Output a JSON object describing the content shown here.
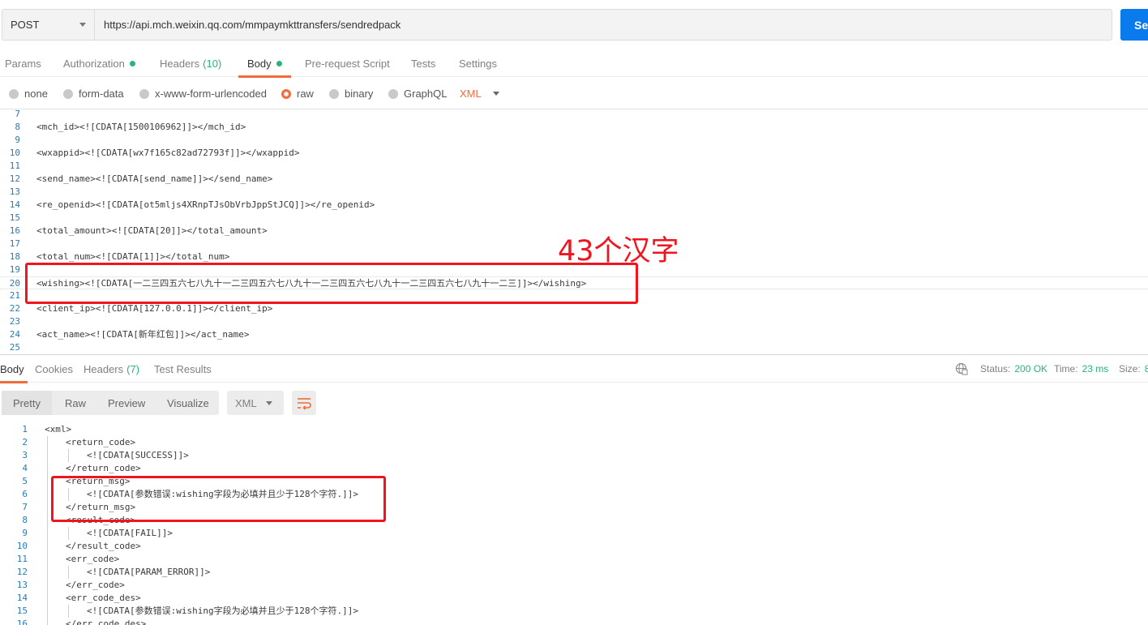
{
  "request": {
    "method": "POST",
    "url": "https://api.mch.weixin.qq.com/mmpaymkttransfers/sendredpack",
    "send_label": "Se"
  },
  "request_tabs": [
    {
      "label": "Params"
    },
    {
      "label": "Authorization"
    },
    {
      "label": "Headers",
      "count": "(10)"
    },
    {
      "label": "Body"
    },
    {
      "label": "Pre-request Script"
    },
    {
      "label": "Tests"
    },
    {
      "label": "Settings"
    }
  ],
  "body_types": [
    {
      "label": "none"
    },
    {
      "label": "form-data"
    },
    {
      "label": "x-www-form-urlencoded"
    },
    {
      "label": "raw"
    },
    {
      "label": "binary"
    },
    {
      "label": "GraphQL"
    }
  ],
  "body_format": "XML",
  "editor_lines": [
    {
      "num": "7",
      "code": ""
    },
    {
      "num": "8",
      "code": "<mch_id><![CDATA[1500106962]]></mch_id>"
    },
    {
      "num": "9",
      "code": ""
    },
    {
      "num": "10",
      "code": "<wxappid><![CDATA[wx7f165c82ad72793f]]></wxappid>"
    },
    {
      "num": "11",
      "code": ""
    },
    {
      "num": "12",
      "code": "<send_name><![CDATA[send_name]]></send_name>"
    },
    {
      "num": "13",
      "code": ""
    },
    {
      "num": "14",
      "code": "<re_openid><![CDATA[ot5mljs4XRnpTJsObVrbJppStJCQ]]></re_openid>"
    },
    {
      "num": "15",
      "code": ""
    },
    {
      "num": "16",
      "code": "<total_amount><![CDATA[20]]></total_amount>"
    },
    {
      "num": "17",
      "code": ""
    },
    {
      "num": "18",
      "code": "<total_num><![CDATA[1]]></total_num>"
    },
    {
      "num": "19",
      "code": ""
    },
    {
      "num": "20",
      "code": "<wishing><![CDATA[一二三四五六七八九十一二三四五六七八九十一二三四五六七八九十一二三四五六七八九十一二三]]></wishing>"
    },
    {
      "num": "21",
      "code": ""
    },
    {
      "num": "22",
      "code": "<client_ip><![CDATA[127.0.0.1]]></client_ip>"
    },
    {
      "num": "23",
      "code": ""
    },
    {
      "num": "24",
      "code": "<act_name><![CDATA[新年红包]]></act_name>"
    },
    {
      "num": "25",
      "code": ""
    }
  ],
  "annotation": "43个汉字",
  "response_tabs": [
    {
      "label": "Body"
    },
    {
      "label": "Cookies"
    },
    {
      "label": "Headers",
      "count": "(7)"
    },
    {
      "label": "Test Results"
    }
  ],
  "response_status": {
    "status_label": "Status:",
    "status_value": "200 OK",
    "time_label": "Time:",
    "time_value": "23 ms",
    "size_label": "Size:",
    "size_value": "8"
  },
  "view_tabs": [
    "Pretty",
    "Raw",
    "Preview",
    "Visualize"
  ],
  "response_format": "XML",
  "response_lines": [
    {
      "num": "1",
      "indent": 0,
      "code": "<xml>"
    },
    {
      "num": "2",
      "indent": 1,
      "code": "<return_code>"
    },
    {
      "num": "3",
      "indent": 2,
      "code": "<![CDATA[SUCCESS]]>"
    },
    {
      "num": "4",
      "indent": 1,
      "code": "</return_code>"
    },
    {
      "num": "5",
      "indent": 1,
      "code": "<return_msg>"
    },
    {
      "num": "6",
      "indent": 2,
      "code": "<![CDATA[参数错误:wishing字段为必填并且少于128个字符.]]>"
    },
    {
      "num": "7",
      "indent": 1,
      "code": "</return_msg>"
    },
    {
      "num": "8",
      "indent": 1,
      "code": "<result_code>"
    },
    {
      "num": "9",
      "indent": 2,
      "code": "<![CDATA[FAIL]]>"
    },
    {
      "num": "10",
      "indent": 1,
      "code": "</result_code>"
    },
    {
      "num": "11",
      "indent": 1,
      "code": "<err_code>"
    },
    {
      "num": "12",
      "indent": 2,
      "code": "<![CDATA[PARAM_ERROR]]>"
    },
    {
      "num": "13",
      "indent": 1,
      "code": "</err_code>"
    },
    {
      "num": "14",
      "indent": 1,
      "code": "<err_code_des>"
    },
    {
      "num": "15",
      "indent": 2,
      "code": "<![CDATA[参数错误:wishing字段为必填并且少于128个字符.]]>"
    },
    {
      "num": "16",
      "indent": 1,
      "code": "</err_code_des>"
    }
  ],
  "colors": {
    "accent": "#f26b3a",
    "success": "#26b47f",
    "send_button": "#097bed",
    "annotation_red": "#f0141e",
    "line_number": "#2b7bb0"
  }
}
